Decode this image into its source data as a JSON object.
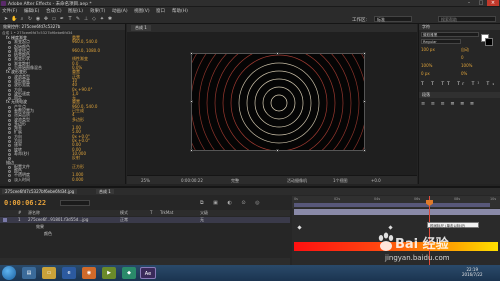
{
  "window": {
    "title": "Adobe After Effects - 未命名项目.aep *"
  },
  "menu": [
    "文件(F)",
    "编辑(E)",
    "合成(C)",
    "图层(L)",
    "效果(T)",
    "动画(A)",
    "视图(V)",
    "窗口",
    "帮助(H)"
  ],
  "toolbar": {
    "workspace_label": "工作区:",
    "workspace_value": "标准",
    "search_placeholder": "搜索帮助"
  },
  "effects_panel": {
    "tab": "效果控件: 275cee6fd7c5327b",
    "comp_line": "合成 1 • 275cee6fd7c5327bf6ebe6fd34",
    "rows": [
      {
        "label": "fx 梯度渐变",
        "value": "重置",
        "group": true
      },
      {
        "label": "渐变起点",
        "value": "960.0, 540.0"
      },
      {
        "label": "起始颜色",
        "value": ""
      },
      {
        "label": "渐变终点",
        "value": "960.0, 1080.0"
      },
      {
        "label": "结束颜色",
        "value": ""
      },
      {
        "label": "渐变形状",
        "value": "线性渐变"
      },
      {
        "label": "渐变散射",
        "value": "0.0"
      },
      {
        "label": "与原始图像混合",
        "value": "0.0%"
      },
      {
        "label": "fx 波形变形",
        "value": "重置",
        "group": true
      },
      {
        "label": "波浪类型",
        "value": "正弦"
      },
      {
        "label": "波形高度",
        "value": "10"
      },
      {
        "label": "波形宽度",
        "value": "40"
      },
      {
        "label": "方向",
        "value": "0x +90.0°"
      },
      {
        "label": "波形速度",
        "value": "1.0"
      },
      {
        "label": "固定",
        "value": "无"
      },
      {
        "label": "fx 无线电波",
        "value": "重置",
        "group": true
      },
      {
        "label": "产生点",
        "value": "960.0, 540.0"
      },
      {
        "label": "参数设置为",
        "value": "已生成"
      },
      {
        "label": "渲染品质",
        "value": "4"
      },
      {
        "label": "波浪类型",
        "value": "多边形"
      },
      {
        "label": "多边形",
        "value": ""
      },
      {
        "label": "频率",
        "value": "1.00"
      },
      {
        "label": "扩展",
        "value": "5.00"
      },
      {
        "label": "方向",
        "value": "0x +0.0°"
      },
      {
        "label": "方向",
        "value": "0x +0.0°"
      },
      {
        "label": "速率",
        "value": "0.00"
      },
      {
        "label": "旋转",
        "value": "0.00"
      },
      {
        "label": "寿命(秒)",
        "value": "10.000"
      },
      {
        "label": "",
        "value": "反射"
      },
      {
        "label": "描边",
        "value": "",
        "group": true
      },
      {
        "label": "配置文件",
        "value": "正方形"
      },
      {
        "label": "颜色",
        "value": ""
      },
      {
        "label": "不透明度",
        "value": "1.000"
      },
      {
        "label": "淡入时间",
        "value": "0.000"
      }
    ]
  },
  "comp_panel": {
    "tab": "合成 1",
    "bottom": [
      "25%",
      "0:00:00:22",
      "完整",
      "活动摄像机",
      "1个视图",
      "+0.0"
    ]
  },
  "right_panel": {
    "rows": [
      "字符",
      "微软雅黑",
      "Regular",
      "100 px",
      "自动",
      "0",
      "100%",
      "100%",
      "0 px",
      "0%",
      "段落"
    ]
  },
  "timeline": {
    "tabs": [
      "275cee6fd7c5327bf6ebe6fd34.jpg",
      "合成 1"
    ],
    "timecode": "0:00:06:22",
    "header": [
      "#",
      "源名称",
      "模式",
      "T",
      "TrkMat",
      "父级"
    ],
    "layers": [
      {
        "num": "1",
        "name": "275cee6f...91801.f3d55d...jpg",
        "mode": "正常",
        "parent": "无"
      },
      {
        "num": "",
        "name": "效果",
        "mode": "",
        "parent": ""
      },
      {
        "num": "",
        "name": "颜色",
        "mode": "",
        "parent": ""
      }
    ],
    "tooltip": "时间标尺 (单击以标记)",
    "ruler_labels": [
      "0s",
      "02s",
      "04s",
      "06s",
      "08s",
      "10s"
    ]
  },
  "taskbar": {
    "time": "22:19",
    "date": "2016/7/22",
    "active_app": "Ae"
  },
  "watermark": {
    "brand": "Bai 经验",
    "url": "jingyan.baidu.com"
  },
  "colors": {
    "accent": "#e0a43a",
    "ring": "#c0463a",
    "gradient_start": "#ff1010",
    "gradient_end": "#ffe000"
  }
}
